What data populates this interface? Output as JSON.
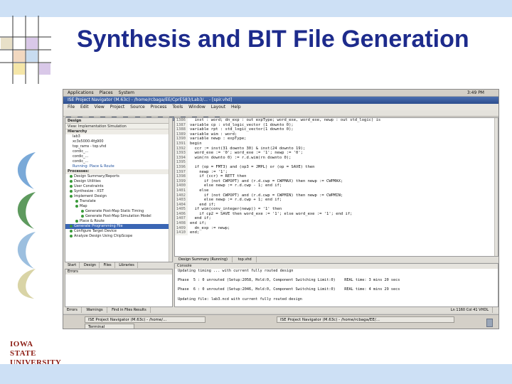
{
  "slide": {
    "title": "Synthesis and BIT File Generation",
    "logo_line1": "IOWA STATE",
    "logo_line2": "UNIVERSITY"
  },
  "screenshot": {
    "panel_items": [
      "Applications",
      "Places",
      "System"
    ],
    "clock": "3:49 PM",
    "window_title": "ISE Project Navigator (M.63c) - /home/rcbaga/EE/CprE583/Lab3/... - [spir.vhd]",
    "menu_items": [
      "File",
      "Edit",
      "View",
      "Project",
      "Source",
      "Process",
      "Tools",
      "Window",
      "Layout",
      "Help"
    ],
    "design_label": "Design",
    "sources_bar": "View:  Implementation   Simulation",
    "hierarchy_header": "Hierarchy",
    "hierarchy": [
      "lab3",
      "xc3s5000-4fg900",
      "top_rams - top.vhd",
      "cordic_...",
      "cordic_...",
      "cordic_..."
    ],
    "processes_header": "Processes: ",
    "processes": [
      "Design Summary/Reports",
      "Design Utilities",
      "User Constraints",
      "Synthesize - XST",
      "Implement Design",
      "Translate",
      "Map",
      "Generate Post-Map Static Timing",
      "Generate Post-Map Simulation Model",
      "Place & Route",
      "Generate Programming File",
      "Configure Target Device",
      "Analyze Design Using ChipScope"
    ],
    "selected_process": "Generate Programming File",
    "running": "Running: Place & Route",
    "left_tabs": [
      "Start",
      "Design",
      "Files",
      "Libraries"
    ],
    "editor_tabs": [
      "Design Summary (Running)",
      "top.vhd"
    ],
    "code": [
      {
        "n": "1386",
        "t": "  inst : word; dn_exp : out expType; word_exe, word_exe, newp : out std_logic) is"
      },
      {
        "n": "1387",
        "t": "variable cp : std_logic_vector (1 downto 0);"
      },
      {
        "n": "1388",
        "t": "variable rpt : std_logic_vector(1 downto 0);"
      },
      {
        "n": "1389",
        "t": "variable wim : word;"
      },
      {
        "n": "1390",
        "t": "variable newp : expType;"
      },
      {
        "n": "1391",
        "t": "begin"
      },
      {
        "n": "1392",
        "t": "  ccr := inst(31 downto 30) & inst(24 downto 19);"
      },
      {
        "n": "1393",
        "t": "  word_exe := '0'; word_exe := '1'; newp := '0';"
      },
      {
        "n": "1394",
        "t": "  wim(rn downto 0) := r.d.wim(rn downto 0);"
      },
      {
        "n": "1395",
        "t": ""
      },
      {
        "n": "1396",
        "t": "  if (op = FMT3) and (op3 = JMPL) or (op = SAVE) then"
      },
      {
        "n": "1397",
        "t": "    newp := '1';"
      },
      {
        "n": "1398",
        "t": "    if (ccr) = RETT then"
      },
      {
        "n": "1399",
        "t": "      if (not CWPOPT) and (r.d.cwp = CWPMAX) then newp := CWPMAX;"
      },
      {
        "n": "1400",
        "t": "      else newp := r.d.cwp - 1; end if;"
      },
      {
        "n": "1401",
        "t": "    else"
      },
      {
        "n": "1402",
        "t": "      if (not CWPOPT) and (r.d.cwp = CWPMIN) then newp := CWPMIN;"
      },
      {
        "n": "1403",
        "t": "      else newp := r.d.cwp + 1; end if;"
      },
      {
        "n": "1404",
        "t": "    end if;"
      },
      {
        "n": "1405",
        "t": "  if wim(conv_integer(newp)) = '1' then"
      },
      {
        "n": "1406",
        "t": "    if cp2 = SAVE then word_exe := '1'; else word_exe := '1'; end if;"
      },
      {
        "n": "1407",
        "t": "  end if;"
      },
      {
        "n": "1408",
        "t": "end if;"
      },
      {
        "n": "1409",
        "t": "  dn_exp := newp;"
      },
      {
        "n": "1410",
        "t": "end;"
      }
    ],
    "errors_header": "Errors",
    "console_header": "Console",
    "console_lines": [
      "Updating timing ... with current fully routed design",
      "",
      "Phase  5 : 0 unrouted (Setup:2058, Hold:0, Component Switching Limit:0)    REAL time: 3 mins 20 secs",
      "",
      "Phase  6 : 0 unrouted (Setup:2046, Hold:0, Component Switching Limit:0)    REAL time: 4 mins 29 secs",
      "",
      "Updating file: lab3.ncd with current fully routed design"
    ],
    "bottom_tabs": [
      "Errors",
      "Warnings",
      "Find in Files Results"
    ],
    "status_text": "Ln 1160 Col 41   VHDL",
    "tasks": [
      "Terminal",
      "ISE Project Navigator (M.63c) - /home/...",
      "ISE Project Navigator (M.63c) - /home/rcbaga/EE/..."
    ]
  }
}
